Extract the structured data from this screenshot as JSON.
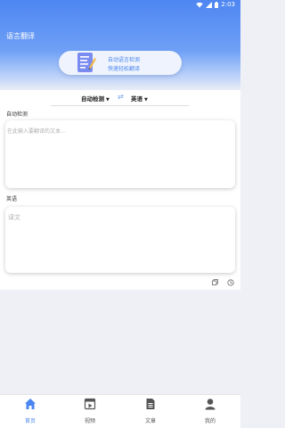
{
  "status": {
    "time": "2:03"
  },
  "app": {
    "title": "语言翻译"
  },
  "promo": {
    "line1": "自动语言检测",
    "line2": "快速轻松翻译"
  },
  "languages": {
    "source": "自动检测",
    "target": "英语"
  },
  "source_panel": {
    "label": "自动检测",
    "placeholder": "在此输入要翻译的文本..."
  },
  "target_panel": {
    "label": "英语",
    "placeholder": "译文"
  },
  "tabs": [
    {
      "label": "首页",
      "icon": "home-icon",
      "active": true
    },
    {
      "label": "视频",
      "icon": "video-icon",
      "active": false
    },
    {
      "label": "文章",
      "icon": "article-icon",
      "active": false
    },
    {
      "label": "我的",
      "icon": "profile-icon",
      "active": false
    }
  ],
  "colors": {
    "accent": "#4a86f0",
    "header_top": "#4e86f2",
    "background": "#eef0f5"
  }
}
